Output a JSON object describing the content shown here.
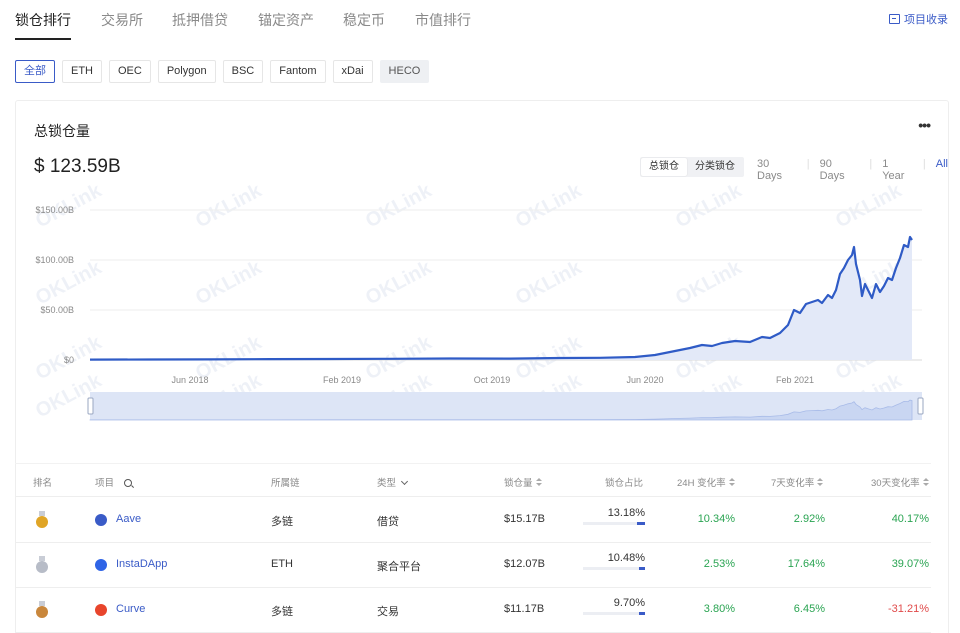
{
  "nav": {
    "tabs": [
      "锁仓排行",
      "交易所",
      "抵押借贷",
      "锚定资产",
      "稳定币",
      "市值排行"
    ],
    "collect": "项目收录"
  },
  "chains": [
    "全部",
    "ETH",
    "OEC",
    "Polygon",
    "BSC",
    "Fantom",
    "xDai",
    "HECO"
  ],
  "card": {
    "title": "总锁仓量",
    "more": "•••",
    "total": "$ 123.59B",
    "toggle": [
      "总锁仓",
      "分类锁仓"
    ],
    "ranges": [
      "30 Days",
      "90 Days",
      "1 Year",
      "All"
    ]
  },
  "watermark": "OKLink",
  "chart_data": {
    "type": "area",
    "ylim": [
      0,
      150
    ],
    "y_ticks": [
      "$150.00B",
      "$100.00B",
      "$50.00B",
      "$0"
    ],
    "x_ticks": [
      "Jun 2018",
      "Feb 2019",
      "Oct 2019",
      "Jun 2020",
      "Feb 2021"
    ],
    "series": [
      {
        "points": [
          [
            0,
            0.4
          ],
          [
            60,
            0.5
          ],
          [
            120,
            0.6
          ],
          [
            180,
            0.9
          ],
          [
            240,
            1.0
          ],
          [
            300,
            1.2
          ],
          [
            360,
            1.5
          ],
          [
            420,
            1.4
          ],
          [
            470,
            2.0
          ],
          [
            510,
            2.2
          ],
          [
            545,
            3.0
          ],
          [
            565,
            5.0
          ],
          [
            585,
            9.0
          ],
          [
            600,
            12.0
          ],
          [
            612,
            15.0
          ],
          [
            622,
            14.0
          ],
          [
            632,
            17.0
          ],
          [
            645,
            19.0
          ],
          [
            660,
            18.0
          ],
          [
            672,
            23.0
          ],
          [
            680,
            22.0
          ],
          [
            690,
            27.0
          ],
          [
            698,
            35.0
          ],
          [
            704,
            50.0
          ],
          [
            710,
            47.0
          ],
          [
            716,
            56.0
          ],
          [
            722,
            58.0
          ],
          [
            728,
            60.0
          ],
          [
            732,
            57.0
          ],
          [
            738,
            65.0
          ],
          [
            742,
            62.0
          ],
          [
            746,
            70.0
          ],
          [
            750,
            86.0
          ],
          [
            754,
            92.0
          ],
          [
            758,
            100.0
          ],
          [
            762,
            105.0
          ],
          [
            764,
            113.0
          ],
          [
            766,
            96.0
          ],
          [
            770,
            80.0
          ],
          [
            772,
            64.0
          ],
          [
            775,
            76.0
          ],
          [
            778,
            70.0
          ],
          [
            782,
            62.0
          ],
          [
            786,
            76.0
          ],
          [
            790,
            68.0
          ],
          [
            794,
            74.0
          ],
          [
            798,
            82.0
          ],
          [
            802,
            80.0
          ],
          [
            806,
            92.0
          ],
          [
            810,
            102.0
          ],
          [
            814,
            115.0
          ],
          [
            818,
            113.0
          ],
          [
            820,
            123.0
          ],
          [
            822,
            120.0
          ]
        ]
      }
    ]
  },
  "table": {
    "headers": {
      "rank": "排名",
      "project": "项目",
      "chain": "所属链",
      "type": "类型",
      "tvl": "锁仓量",
      "share": "锁仓占比",
      "chg24h": "24H 变化率",
      "chg7d": "7天变化率",
      "chg30d": "30天变化率"
    },
    "rows": [
      {
        "name": "Aave",
        "chain": "多链",
        "type": "借贷",
        "tvl": "$15.17B",
        "share": "13.18%",
        "share_pct": 13.18,
        "chg24h": "10.34%",
        "chg7d": "2.92%",
        "chg30d": "40.17%",
        "medal_color": "#e0a526",
        "logo_color": "#3a5bc7"
      },
      {
        "name": "InstaDApp",
        "chain": "ETH",
        "type": "聚合平台",
        "tvl": "$12.07B",
        "share": "10.48%",
        "share_pct": 10.48,
        "chg24h": "2.53%",
        "chg7d": "17.64%",
        "chg30d": "39.07%",
        "medal_color": "#b7bcc7",
        "logo_color": "#2f64e6"
      },
      {
        "name": "Curve",
        "chain": "多链",
        "type": "交易",
        "tvl": "$11.17B",
        "share": "9.70%",
        "share_pct": 9.7,
        "chg24h": "3.80%",
        "chg7d": "6.45%",
        "chg30d": "-31.21%",
        "medal_color": "#c9873c",
        "logo_color": "#e8452c"
      }
    ]
  }
}
